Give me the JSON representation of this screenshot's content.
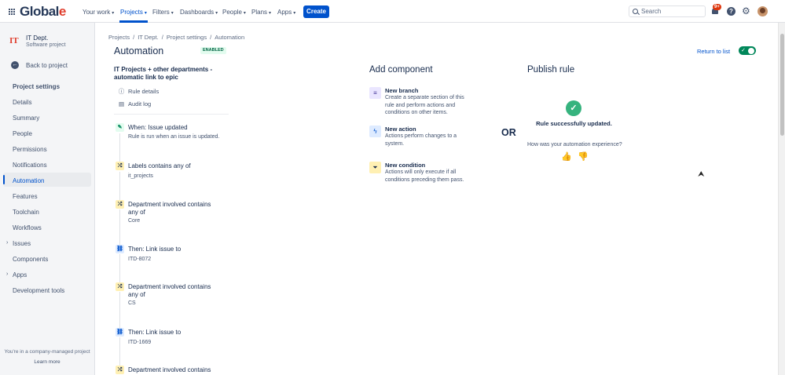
{
  "nav": {
    "logo_main": "Global",
    "logo_accent": "e",
    "items": [
      {
        "label": "Your work",
        "chevron": "▾"
      },
      {
        "label": "Projects",
        "chevron": "▾"
      },
      {
        "label": "Filters",
        "chevron": "▾"
      },
      {
        "label": "Dashboards",
        "chevron": "▾"
      },
      {
        "label": "People",
        "chevron": "▾"
      },
      {
        "label": "Plans",
        "chevron": "▾"
      },
      {
        "label": "Apps",
        "chevron": "▾"
      }
    ],
    "create_label": "Create",
    "search_placeholder": "Search",
    "notification_badge": "9+",
    "help_glyph": "?",
    "gear_glyph": "⚙"
  },
  "sidebar": {
    "project_icon": "IT",
    "project_name": "IT Dept.",
    "project_type": "Software project",
    "back_label": "Back to project",
    "back_glyph": "←",
    "section_heading": "Project settings",
    "items": [
      {
        "label": "Details"
      },
      {
        "label": "Summary"
      },
      {
        "label": "People"
      },
      {
        "label": "Permissions"
      },
      {
        "label": "Notifications"
      },
      {
        "label": "Automation"
      },
      {
        "label": "Features"
      },
      {
        "label": "Toolchain"
      },
      {
        "label": "Workflows"
      },
      {
        "label": "Issues"
      },
      {
        "label": "Components"
      },
      {
        "label": "Apps"
      },
      {
        "label": "Development tools"
      }
    ],
    "footer_text": "You're in a company-managed project",
    "footer_link": "Learn more"
  },
  "breadcrumb": [
    "Projects",
    "IT Dept.",
    "Project settings",
    "Automation"
  ],
  "breadcrumb_sep": "/",
  "header": {
    "title": "Automation",
    "status_badge": "ENABLED",
    "return_link": "Return to list"
  },
  "rule": {
    "name": "IT Projects + other departments - automatic link to epic",
    "links": [
      {
        "label": "Rule details",
        "glyph": "ⓘ"
      },
      {
        "label": "Audit log",
        "glyph": "▤"
      }
    ],
    "steps": [
      {
        "title": "When: Issue updated",
        "desc": "Rule is run when an issue is updated.",
        "glyph": "✎"
      },
      {
        "title": "Labels contains any of",
        "desc": "it_projects",
        "glyph": "⤮"
      },
      {
        "title": "Department involved contains any of",
        "desc": "Core",
        "glyph": "⤮"
      },
      {
        "title": "Then: Link issue to",
        "desc": "ITD-8072",
        "glyph": "⛓"
      },
      {
        "title": "Department involved contains any of",
        "desc": "CS",
        "glyph": "⤮"
      },
      {
        "title": "Then: Link issue to",
        "desc": "ITD-1669",
        "glyph": "⛓"
      },
      {
        "title": "Department involved contains",
        "desc": "",
        "glyph": "⤮"
      }
    ]
  },
  "add_component": {
    "heading": "Add component",
    "items": [
      {
        "title": "New branch",
        "desc": "Create a separate section of this rule and perform actions and conditions on other items.",
        "glyph": "≡"
      },
      {
        "title": "New action",
        "desc": "Actions perform changes to a system.",
        "glyph": "ϟ"
      },
      {
        "title": "New condition",
        "desc": "Actions will only execute if all conditions preceding them pass.",
        "glyph": "⏷"
      }
    ]
  },
  "or_text": "OR",
  "publish": {
    "heading": "Publish rule",
    "success_glyph": "✓",
    "success_text": "Rule successfully updated.",
    "feedback_question": "How was your automation experience?",
    "thumb_up": "👍",
    "thumb_down": "👎"
  },
  "colors": {
    "brand_blue": "#0052cc",
    "logo_accent": "#e03e2d",
    "success_green": "#36b37e",
    "toggle_green": "#00875a"
  }
}
